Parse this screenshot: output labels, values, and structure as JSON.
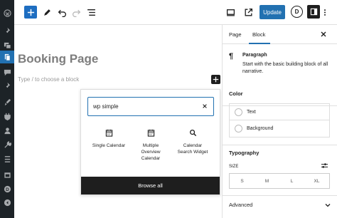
{
  "toolbar": {
    "update_label": "Update",
    "avatar_letter": "D"
  },
  "editor": {
    "title": "Booking Page",
    "placeholder": "Type / to choose a block"
  },
  "inserter": {
    "search_value": "wp simple",
    "results": [
      {
        "label": "Single Calendar",
        "icon": "calendar-icon"
      },
      {
        "label": "Multiple\nOverview\nCalendar",
        "icon": "calendar-icon"
      },
      {
        "label": "Calendar\nSearch Widget",
        "icon": "search-icon"
      }
    ],
    "browse_all": "Browse all"
  },
  "sidebar": {
    "tabs": [
      "Page",
      "Block"
    ],
    "active_tab": "Block",
    "block": {
      "icon": "¶",
      "name": "Paragraph",
      "description": "Start with the basic building block of all narrative."
    },
    "color": {
      "title": "Color",
      "items": [
        "Text",
        "Background"
      ]
    },
    "typography": {
      "title": "Typography",
      "size_label": "SIZE",
      "sizes": [
        "S",
        "M",
        "L",
        "XL"
      ]
    },
    "advanced": {
      "title": "Advanced"
    }
  },
  "colors": {
    "accent": "#2271b1",
    "admin_bg": "#1d2327",
    "dark": "#1e1e1e"
  }
}
